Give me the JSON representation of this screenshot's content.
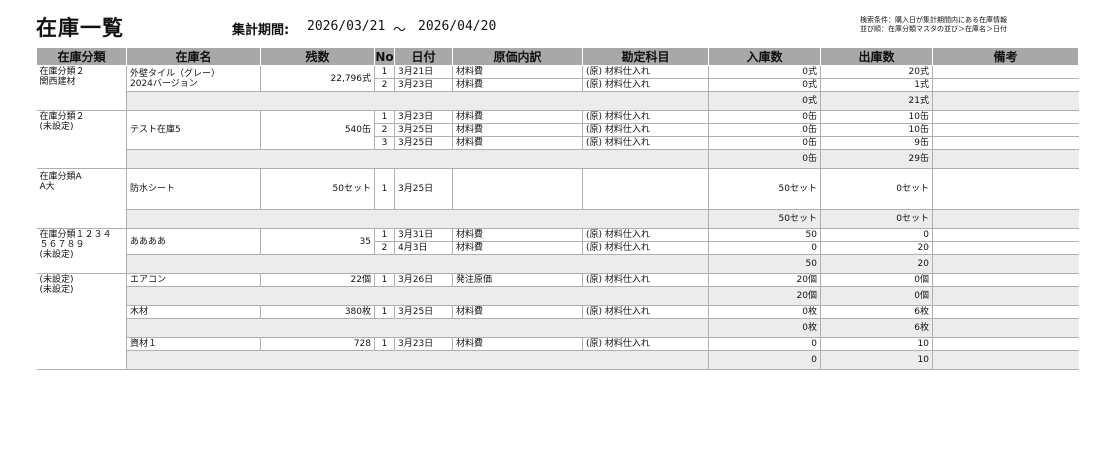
{
  "header": {
    "title": "在庫一覧",
    "period_label": "集計期間:",
    "period_start": "2026/03/21",
    "period_separator": "～",
    "period_end": "2026/04/20",
    "search_condition_1": "検索条件：購入日が集計期間内にある在庫情報",
    "search_condition_2": "並び順：在庫分類マスタの並び＞在庫名＞日付"
  },
  "columns": {
    "category": "在庫分類",
    "name": "在庫名",
    "remaining": "残数",
    "no": "No",
    "date": "日付",
    "cost": "原価内訳",
    "account": "勘定科目",
    "in": "入庫数",
    "out": "出庫数",
    "memo": "備考"
  },
  "groups": [
    {
      "cat1": "在庫分類２",
      "cat2": "関西建材",
      "name1": "外壁タイル（グレー）",
      "name2": "2024バージョン",
      "remaining": "22,796式",
      "rows": [
        {
          "no": "1",
          "date": "3月21日",
          "cost": "材料費",
          "account": "(原) 材料仕入れ",
          "in": "0式",
          "out": "20式"
        },
        {
          "no": "2",
          "date": "3月23日",
          "cost": "材料費",
          "account": "(原) 材料仕入れ",
          "in": "0式",
          "out": "1式"
        }
      ],
      "sub_in": "0式",
      "sub_out": "21式"
    },
    {
      "cat1": "在庫分類２",
      "cat2": "(未設定)",
      "name1": "テスト在庫5",
      "remaining": "540缶",
      "rows": [
        {
          "no": "1",
          "date": "3月23日",
          "cost": "材料費",
          "account": "(原) 材料仕入れ",
          "in": "0缶",
          "out": "10缶"
        },
        {
          "no": "2",
          "date": "3月25日",
          "cost": "材料費",
          "account": "(原) 材料仕入れ",
          "in": "0缶",
          "out": "10缶"
        },
        {
          "no": "3",
          "date": "3月25日",
          "cost": "材料費",
          "account": "(原) 材料仕入れ",
          "in": "0缶",
          "out": "9缶"
        }
      ],
      "sub_in": "0缶",
      "sub_out": "29缶"
    },
    {
      "cat1": "在庫分類A",
      "cat2": "A大",
      "name1": "防水シート",
      "remaining": "50セット",
      "rows": [
        {
          "no": "1",
          "date": "3月25日",
          "cost": "",
          "account": "",
          "in": "50セット",
          "out": "0セット"
        }
      ],
      "sub_in": "50セット",
      "sub_out": "0セット"
    },
    {
      "cat1": "在庫分類１２３４",
      "cat2": "５６７８９",
      "cat3": "(未設定)",
      "name1": "ああああ",
      "remaining": "35",
      "rows": [
        {
          "no": "1",
          "date": "3月31日",
          "cost": "材料費",
          "account": "(原) 材料仕入れ",
          "in": "50",
          "out": "0"
        },
        {
          "no": "2",
          "date": "4月3日",
          "cost": "材料費",
          "account": "(原) 材料仕入れ",
          "in": "0",
          "out": "20"
        }
      ],
      "sub_in": "50",
      "sub_out": "20"
    },
    {
      "cat1": "(未設定)",
      "cat2": "(未設定)",
      "items": [
        {
          "name1": "エアコン",
          "remaining": "22個",
          "rows": [
            {
              "no": "1",
              "date": "3月26日",
              "cost": "発注原価",
              "account": "(原) 材料仕入れ",
              "in": "20個",
              "out": "0個"
            }
          ],
          "sub_in": "20個",
          "sub_out": "0個"
        },
        {
          "name1": "木材",
          "remaining": "380枚",
          "rows": [
            {
              "no": "1",
              "date": "3月25日",
              "cost": "材料費",
              "account": "(原) 材料仕入れ",
              "in": "0枚",
              "out": "6枚"
            }
          ],
          "sub_in": "0枚",
          "sub_out": "6枚"
        },
        {
          "name1": "資材１",
          "remaining": "728",
          "rows": [
            {
              "no": "1",
              "date": "3月23日",
              "cost": "材料費",
              "account": "(原) 材料仕入れ",
              "in": "0",
              "out": "10"
            }
          ],
          "sub_in": "0",
          "sub_out": "10"
        }
      ]
    }
  ]
}
